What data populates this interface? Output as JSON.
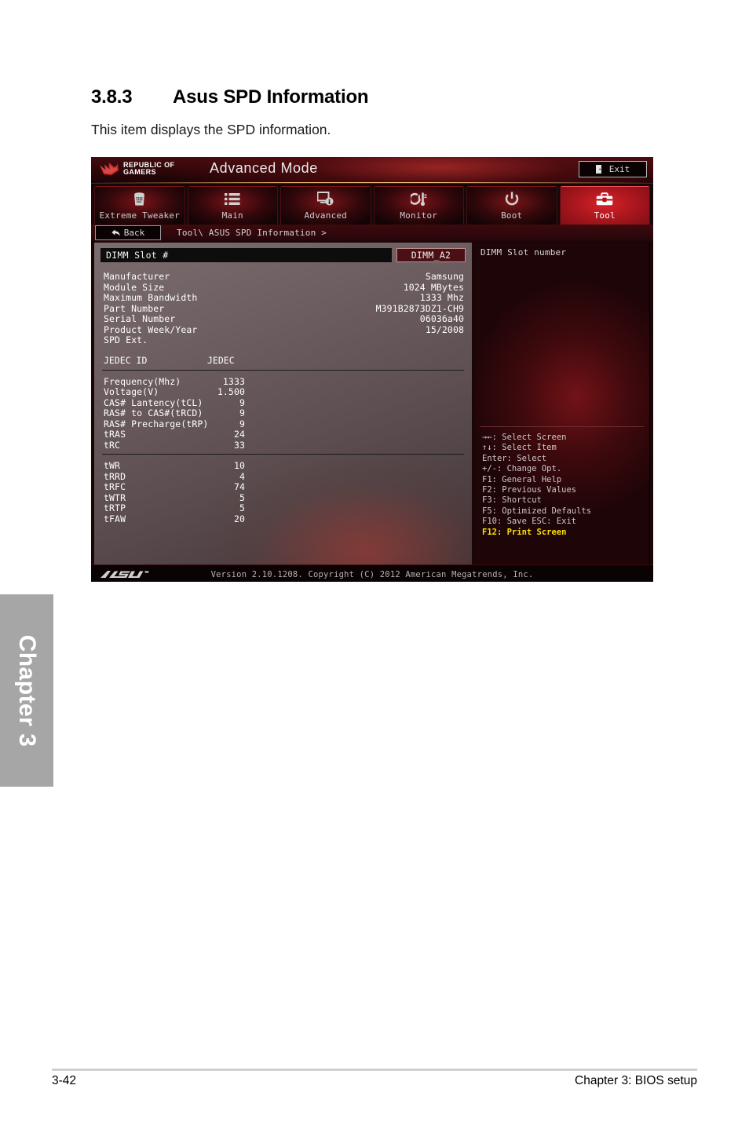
{
  "document": {
    "section_number": "3.8.3",
    "section_title": "Asus SPD Information",
    "intro_text": "This item displays the SPD information.",
    "chapter_tab": "Chapter 3",
    "footer_page": "3-42",
    "footer_chapter": "Chapter 3: BIOS setup"
  },
  "bios": {
    "banner": {
      "logo_line1": "REPUBLIC OF",
      "logo_line2": "GAMERS",
      "mode_title": "Advanced Mode",
      "exit_label": "Exit"
    },
    "tabs": [
      {
        "label": "Extreme Tweaker",
        "icon": "tweaker-icon",
        "active": false
      },
      {
        "label": "Main",
        "icon": "list-icon",
        "active": false
      },
      {
        "label": "Advanced",
        "icon": "monitor-info-icon",
        "active": false
      },
      {
        "label": "Monitor",
        "icon": "gauge-icon",
        "active": false
      },
      {
        "label": "Boot",
        "icon": "power-icon",
        "active": false
      },
      {
        "label": "Tool",
        "icon": "toolbox-icon",
        "active": true
      }
    ],
    "breadcrumb": {
      "back_label": "Back",
      "path": "Tool\\ ASUS SPD Information >"
    },
    "main": {
      "slot_label": "DIMM Slot #",
      "slot_value": "DIMM_A2",
      "info_rows": [
        {
          "key": "Manufacturer",
          "value": "Samsung"
        },
        {
          "key": "Module Size",
          "value": "1024 MBytes"
        },
        {
          "key": "Maximum Bandwidth",
          "value": "1333 Mhz"
        },
        {
          "key": "Part Number",
          "value": "M391B2873DZ1-CH9"
        },
        {
          "key": "Serial Number",
          "value": "06036a40"
        },
        {
          "key": "Product Week/Year",
          "value": "15/2008"
        },
        {
          "key": "SPD Ext.",
          "value": ""
        }
      ],
      "jedec_header": {
        "col1": "JEDEC ID",
        "col2": "JEDEC"
      },
      "timings_primary": [
        {
          "key": "Frequency(Mhz)",
          "value": "1333"
        },
        {
          "key": "Voltage(V)",
          "value": "1.500"
        },
        {
          "key": "CAS# Lantency(tCL)",
          "value": "9"
        },
        {
          "key": "RAS# to CAS#(tRCD)",
          "value": "9"
        },
        {
          "key": "RAS# Precharge(tRP)",
          "value": "9"
        },
        {
          "key": "tRAS",
          "value": "24"
        },
        {
          "key": "tRC",
          "value": "33"
        }
      ],
      "timings_secondary": [
        {
          "key": "tWR",
          "value": "10"
        },
        {
          "key": "tRRD",
          "value": "4"
        },
        {
          "key": "tRFC",
          "value": "74"
        },
        {
          "key": "tWTR",
          "value": "5"
        },
        {
          "key": "tRTP",
          "value": "5"
        },
        {
          "key": "tFAW",
          "value": "20"
        }
      ]
    },
    "help": {
      "title": "DIMM Slot number",
      "keys": [
        {
          "text": "→←: Select Screen",
          "highlight": false
        },
        {
          "text": "↑↓: Select Item",
          "highlight": false
        },
        {
          "text": "Enter: Select",
          "highlight": false
        },
        {
          "text": "+/-: Change Opt.",
          "highlight": false
        },
        {
          "text": "F1: General Help",
          "highlight": false
        },
        {
          "text": "F2: Previous Values",
          "highlight": false
        },
        {
          "text": "F3: Shortcut",
          "highlight": false
        },
        {
          "text": "F5: Optimized Defaults",
          "highlight": false
        },
        {
          "text": "F10: Save  ESC: Exit",
          "highlight": false
        },
        {
          "text": "F12: Print Screen",
          "highlight": true
        }
      ]
    },
    "footer": {
      "brand": "ASUS",
      "version": "Version 2.10.1208. Copyright (C) 2012 American Megatrends, Inc."
    },
    "colors": {
      "accent_red": "#a9161d",
      "highlight_yellow": "#ffe000",
      "panel_gray": "#6e5f62"
    }
  }
}
